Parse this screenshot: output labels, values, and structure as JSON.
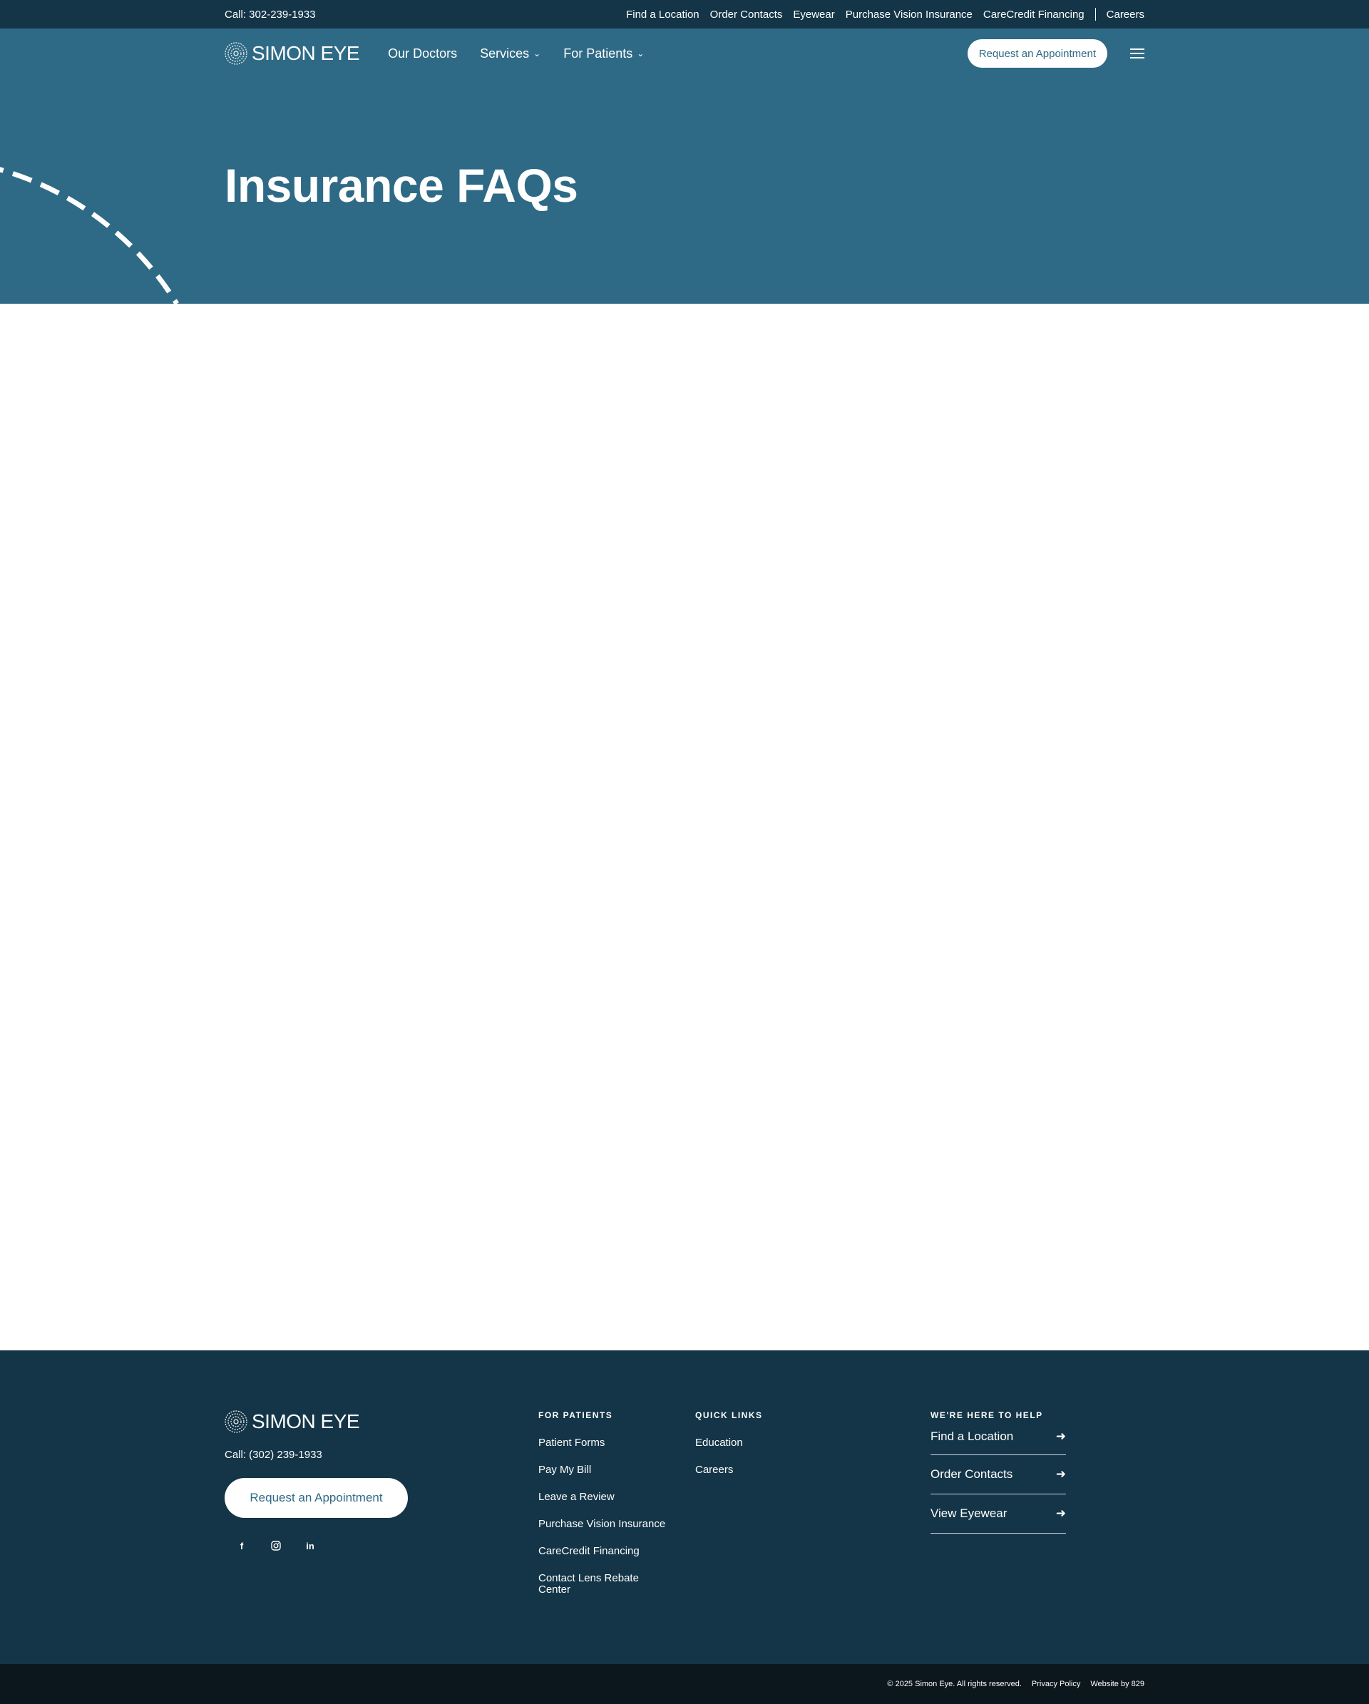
{
  "topbar": {
    "call": "Call: 302-239-1933",
    "links": [
      "Find a Location",
      "Order Contacts",
      "Eyewear",
      "Purchase Vision Insurance",
      "CareCredit Financing"
    ],
    "careers": "Careers"
  },
  "header": {
    "logo_text": "SIMON EYE",
    "nav": [
      {
        "label": "Our Doctors"
      },
      {
        "label": "Services"
      },
      {
        "label": "For Patients"
      }
    ],
    "appointment_label": "Request an Appointment",
    "menu_icon": "hamburger-menu-icon"
  },
  "hero": {
    "title": "Insurance FAQs"
  },
  "footer": {
    "logo_text": "SIMON EYE",
    "call": "Call: (302) 239-1933",
    "appointment_label": "Request an Appointment",
    "socials": [
      "facebook-icon",
      "instagram-icon",
      "linkedin-icon"
    ],
    "for_patients": {
      "heading": "FOR PATIENTS",
      "items": [
        "Patient Forms",
        "Pay My Bill",
        "Leave a Review",
        "Purchase Vision Insurance",
        "CareCredit Financing",
        "Contact Lens Rebate Center"
      ]
    },
    "quick_links": {
      "heading": "QUICK LINKS",
      "items": [
        "Education",
        "Careers"
      ]
    },
    "help": {
      "heading": "WE'RE HERE TO HELP",
      "items": [
        "Find a Location",
        "Order Contacts",
        "View Eyewear"
      ]
    }
  },
  "bottombar": {
    "copyright": "© 2025 Simon Eye. All rights reserved.",
    "privacy": "Privacy Policy",
    "credit": "Website by 829"
  },
  "colors": {
    "topbar": "#143547",
    "hero": "#2e6a85",
    "footer": "#143547",
    "bottombar": "#0b161d"
  }
}
